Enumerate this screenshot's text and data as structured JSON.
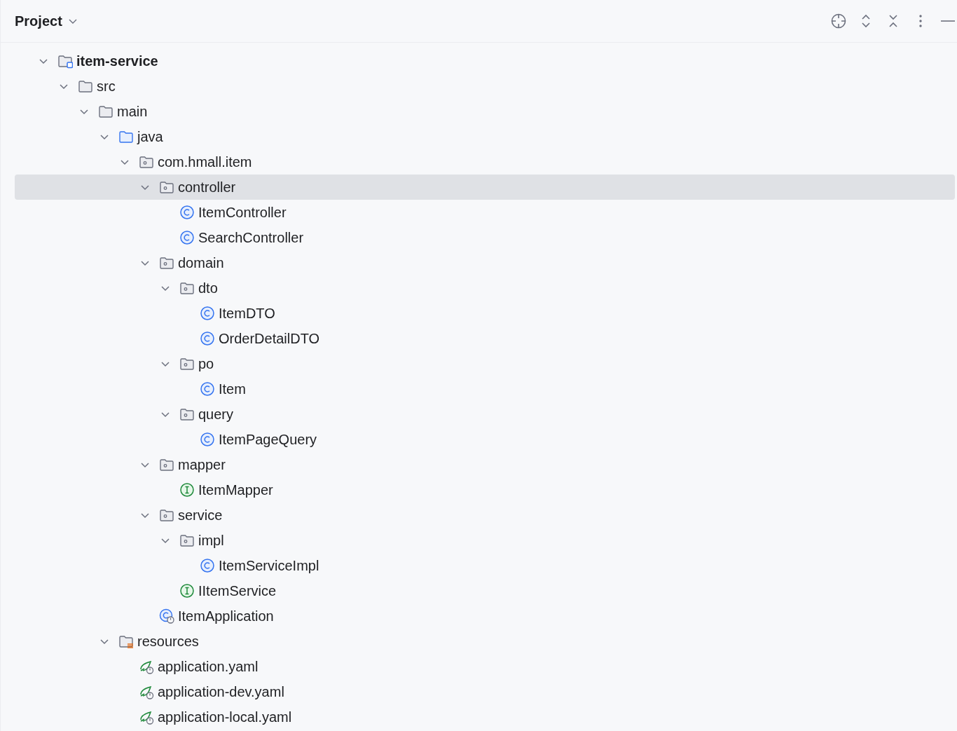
{
  "panel": {
    "title": "Project"
  },
  "tree": [
    {
      "kind": "module",
      "label": "item-service",
      "expanded": true,
      "selected": false,
      "children": [
        {
          "kind": "folder",
          "label": "src",
          "expanded": true,
          "selected": false,
          "children": [
            {
              "kind": "folder",
              "label": "main",
              "expanded": true,
              "selected": false,
              "children": [
                {
                  "kind": "source-folder",
                  "label": "java",
                  "expanded": true,
                  "selected": false,
                  "children": [
                    {
                      "kind": "package",
                      "label": "com.hmall.item",
                      "expanded": true,
                      "selected": false,
                      "children": [
                        {
                          "kind": "package",
                          "label": "controller",
                          "expanded": true,
                          "selected": true,
                          "children": [
                            {
                              "kind": "class",
                              "label": "ItemController",
                              "selected": false
                            },
                            {
                              "kind": "class",
                              "label": "SearchController",
                              "selected": false
                            }
                          ]
                        },
                        {
                          "kind": "package",
                          "label": "domain",
                          "expanded": true,
                          "selected": false,
                          "children": [
                            {
                              "kind": "package",
                              "label": "dto",
                              "expanded": true,
                              "selected": false,
                              "children": [
                                {
                                  "kind": "class",
                                  "label": "ItemDTO",
                                  "selected": false
                                },
                                {
                                  "kind": "class",
                                  "label": "OrderDetailDTO",
                                  "selected": false
                                }
                              ]
                            },
                            {
                              "kind": "package",
                              "label": "po",
                              "expanded": true,
                              "selected": false,
                              "children": [
                                {
                                  "kind": "class",
                                  "label": "Item",
                                  "selected": false
                                }
                              ]
                            },
                            {
                              "kind": "package",
                              "label": "query",
                              "expanded": true,
                              "selected": false,
                              "children": [
                                {
                                  "kind": "class",
                                  "label": "ItemPageQuery",
                                  "selected": false
                                }
                              ]
                            }
                          ]
                        },
                        {
                          "kind": "package",
                          "label": "mapper",
                          "expanded": true,
                          "selected": false,
                          "children": [
                            {
                              "kind": "interface",
                              "label": "ItemMapper",
                              "selected": false
                            }
                          ]
                        },
                        {
                          "kind": "package",
                          "label": "service",
                          "expanded": true,
                          "selected": false,
                          "children": [
                            {
                              "kind": "package",
                              "label": "impl",
                              "expanded": true,
                              "selected": false,
                              "children": [
                                {
                                  "kind": "class",
                                  "label": "ItemServiceImpl",
                                  "selected": false
                                }
                              ]
                            },
                            {
                              "kind": "interface",
                              "label": "IItemService",
                              "selected": false
                            }
                          ]
                        },
                        {
                          "kind": "app-class",
                          "label": "ItemApplication",
                          "selected": false
                        }
                      ]
                    }
                  ]
                },
                {
                  "kind": "resources-folder",
                  "label": "resources",
                  "expanded": true,
                  "selected": false,
                  "children": [
                    {
                      "kind": "spring-config",
                      "label": "application.yaml",
                      "selected": false
                    },
                    {
                      "kind": "spring-config",
                      "label": "application-dev.yaml",
                      "selected": false
                    },
                    {
                      "kind": "spring-config",
                      "label": "application-local.yaml",
                      "selected": false
                    }
                  ]
                }
              ]
            }
          ]
        }
      ]
    }
  ]
}
